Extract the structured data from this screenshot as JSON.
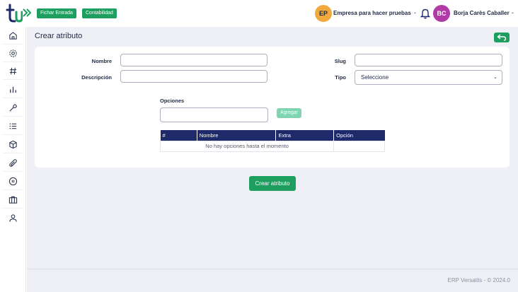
{
  "header": {
    "logo_text": "tu",
    "fichar_label": "Fichar Entrada",
    "contabilidad_label": "Contabilidad",
    "company_initials": "EP",
    "company_name": "Empresa para hacer pruebas",
    "user_initials": "BC",
    "user_name": "Borja Carès Caballer",
    "caret": "⌄",
    "brand_color": "#1e9e5f",
    "company_avatar_color": "#f2a93b",
    "user_avatar_color": "#b23aa6"
  },
  "sidebar": {
    "items": [
      {
        "icon": "home-icon"
      },
      {
        "icon": "gear-icon"
      },
      {
        "icon": "hash-icon"
      },
      {
        "icon": "bar-chart-icon"
      },
      {
        "icon": "wrench-icon"
      },
      {
        "icon": "list-icon"
      },
      {
        "icon": "box-icon"
      },
      {
        "icon": "paperclip-icon"
      },
      {
        "icon": "pause-circle-icon"
      },
      {
        "icon": "briefcase-icon"
      },
      {
        "icon": "user-icon"
      }
    ]
  },
  "page": {
    "title": "Crear atributo"
  },
  "form": {
    "nombre_label": "Nombre",
    "nombre_value": "",
    "slug_label": "Slug",
    "slug_value": "",
    "descripcion_label": "Descripción",
    "descripcion_value": "",
    "tipo_label": "Tipo",
    "tipo_selected": "Seleccione",
    "opciones_label": "Opciones",
    "opciones_value": "",
    "agregar_label": "Agregar"
  },
  "options_table": {
    "headers": [
      "#",
      "Nombre",
      "Extra",
      "Opción"
    ],
    "empty_message": "No hay opciones hasta el momento"
  },
  "actions": {
    "create_label": "Crear atributo"
  },
  "footer": {
    "text": "ERP Versatils - © 2024.0"
  }
}
